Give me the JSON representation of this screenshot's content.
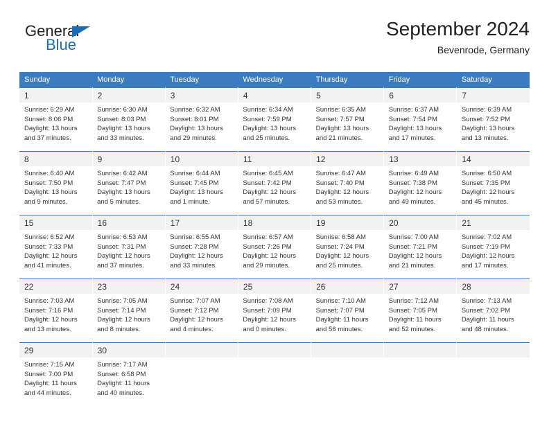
{
  "logo": {
    "primary_text": "General",
    "secondary_text": "Blue",
    "primary_color": "#231f20",
    "secondary_color": "#1b6cb0"
  },
  "header": {
    "title": "September 2024",
    "subtitle": "Bevenrode, Germany"
  },
  "theme": {
    "header_blue": "#3b7cc0",
    "daynum_gray": "#f2f2f2",
    "text": "#333333"
  },
  "weekday_headers": [
    "Sunday",
    "Monday",
    "Tuesday",
    "Wednesday",
    "Thursday",
    "Friday",
    "Saturday"
  ],
  "days": {
    "1": {
      "num": "1",
      "sunrise": "Sunrise: 6:29 AM",
      "sunset": "Sunset: 8:06 PM",
      "daylight1": "Daylight: 13 hours",
      "daylight2": "and 37 minutes."
    },
    "2": {
      "num": "2",
      "sunrise": "Sunrise: 6:30 AM",
      "sunset": "Sunset: 8:03 PM",
      "daylight1": "Daylight: 13 hours",
      "daylight2": "and 33 minutes."
    },
    "3": {
      "num": "3",
      "sunrise": "Sunrise: 6:32 AM",
      "sunset": "Sunset: 8:01 PM",
      "daylight1": "Daylight: 13 hours",
      "daylight2": "and 29 minutes."
    },
    "4": {
      "num": "4",
      "sunrise": "Sunrise: 6:34 AM",
      "sunset": "Sunset: 7:59 PM",
      "daylight1": "Daylight: 13 hours",
      "daylight2": "and 25 minutes."
    },
    "5": {
      "num": "5",
      "sunrise": "Sunrise: 6:35 AM",
      "sunset": "Sunset: 7:57 PM",
      "daylight1": "Daylight: 13 hours",
      "daylight2": "and 21 minutes."
    },
    "6": {
      "num": "6",
      "sunrise": "Sunrise: 6:37 AM",
      "sunset": "Sunset: 7:54 PM",
      "daylight1": "Daylight: 13 hours",
      "daylight2": "and 17 minutes."
    },
    "7": {
      "num": "7",
      "sunrise": "Sunrise: 6:39 AM",
      "sunset": "Sunset: 7:52 PM",
      "daylight1": "Daylight: 13 hours",
      "daylight2": "and 13 minutes."
    },
    "8": {
      "num": "8",
      "sunrise": "Sunrise: 6:40 AM",
      "sunset": "Sunset: 7:50 PM",
      "daylight1": "Daylight: 13 hours",
      "daylight2": "and 9 minutes."
    },
    "9": {
      "num": "9",
      "sunrise": "Sunrise: 6:42 AM",
      "sunset": "Sunset: 7:47 PM",
      "daylight1": "Daylight: 13 hours",
      "daylight2": "and 5 minutes."
    },
    "10": {
      "num": "10",
      "sunrise": "Sunrise: 6:44 AM",
      "sunset": "Sunset: 7:45 PM",
      "daylight1": "Daylight: 13 hours",
      "daylight2": "and 1 minute."
    },
    "11": {
      "num": "11",
      "sunrise": "Sunrise: 6:45 AM",
      "sunset": "Sunset: 7:42 PM",
      "daylight1": "Daylight: 12 hours",
      "daylight2": "and 57 minutes."
    },
    "12": {
      "num": "12",
      "sunrise": "Sunrise: 6:47 AM",
      "sunset": "Sunset: 7:40 PM",
      "daylight1": "Daylight: 12 hours",
      "daylight2": "and 53 minutes."
    },
    "13": {
      "num": "13",
      "sunrise": "Sunrise: 6:49 AM",
      "sunset": "Sunset: 7:38 PM",
      "daylight1": "Daylight: 12 hours",
      "daylight2": "and 49 minutes."
    },
    "14": {
      "num": "14",
      "sunrise": "Sunrise: 6:50 AM",
      "sunset": "Sunset: 7:35 PM",
      "daylight1": "Daylight: 12 hours",
      "daylight2": "and 45 minutes."
    },
    "15": {
      "num": "15",
      "sunrise": "Sunrise: 6:52 AM",
      "sunset": "Sunset: 7:33 PM",
      "daylight1": "Daylight: 12 hours",
      "daylight2": "and 41 minutes."
    },
    "16": {
      "num": "16",
      "sunrise": "Sunrise: 6:53 AM",
      "sunset": "Sunset: 7:31 PM",
      "daylight1": "Daylight: 12 hours",
      "daylight2": "and 37 minutes."
    },
    "17": {
      "num": "17",
      "sunrise": "Sunrise: 6:55 AM",
      "sunset": "Sunset: 7:28 PM",
      "daylight1": "Daylight: 12 hours",
      "daylight2": "and 33 minutes."
    },
    "18": {
      "num": "18",
      "sunrise": "Sunrise: 6:57 AM",
      "sunset": "Sunset: 7:26 PM",
      "daylight1": "Daylight: 12 hours",
      "daylight2": "and 29 minutes."
    },
    "19": {
      "num": "19",
      "sunrise": "Sunrise: 6:58 AM",
      "sunset": "Sunset: 7:24 PM",
      "daylight1": "Daylight: 12 hours",
      "daylight2": "and 25 minutes."
    },
    "20": {
      "num": "20",
      "sunrise": "Sunrise: 7:00 AM",
      "sunset": "Sunset: 7:21 PM",
      "daylight1": "Daylight: 12 hours",
      "daylight2": "and 21 minutes."
    },
    "21": {
      "num": "21",
      "sunrise": "Sunrise: 7:02 AM",
      "sunset": "Sunset: 7:19 PM",
      "daylight1": "Daylight: 12 hours",
      "daylight2": "and 17 minutes."
    },
    "22": {
      "num": "22",
      "sunrise": "Sunrise: 7:03 AM",
      "sunset": "Sunset: 7:16 PM",
      "daylight1": "Daylight: 12 hours",
      "daylight2": "and 13 minutes."
    },
    "23": {
      "num": "23",
      "sunrise": "Sunrise: 7:05 AM",
      "sunset": "Sunset: 7:14 PM",
      "daylight1": "Daylight: 12 hours",
      "daylight2": "and 8 minutes."
    },
    "24": {
      "num": "24",
      "sunrise": "Sunrise: 7:07 AM",
      "sunset": "Sunset: 7:12 PM",
      "daylight1": "Daylight: 12 hours",
      "daylight2": "and 4 minutes."
    },
    "25": {
      "num": "25",
      "sunrise": "Sunrise: 7:08 AM",
      "sunset": "Sunset: 7:09 PM",
      "daylight1": "Daylight: 12 hours",
      "daylight2": "and 0 minutes."
    },
    "26": {
      "num": "26",
      "sunrise": "Sunrise: 7:10 AM",
      "sunset": "Sunset: 7:07 PM",
      "daylight1": "Daylight: 11 hours",
      "daylight2": "and 56 minutes."
    },
    "27": {
      "num": "27",
      "sunrise": "Sunrise: 7:12 AM",
      "sunset": "Sunset: 7:05 PM",
      "daylight1": "Daylight: 11 hours",
      "daylight2": "and 52 minutes."
    },
    "28": {
      "num": "28",
      "sunrise": "Sunrise: 7:13 AM",
      "sunset": "Sunset: 7:02 PM",
      "daylight1": "Daylight: 11 hours",
      "daylight2": "and 48 minutes."
    },
    "29": {
      "num": "29",
      "sunrise": "Sunrise: 7:15 AM",
      "sunset": "Sunset: 7:00 PM",
      "daylight1": "Daylight: 11 hours",
      "daylight2": "and 44 minutes."
    },
    "30": {
      "num": "30",
      "sunrise": "Sunrise: 7:17 AM",
      "sunset": "Sunset: 6:58 PM",
      "daylight1": "Daylight: 11 hours",
      "daylight2": "and 40 minutes."
    }
  }
}
